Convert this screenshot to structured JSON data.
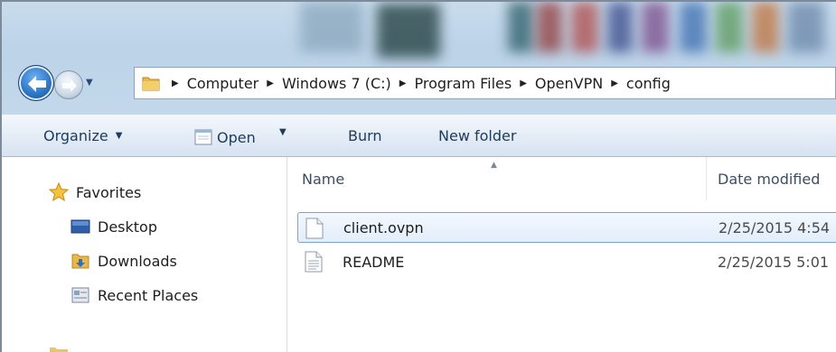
{
  "address_bar": {
    "crumbs": [
      "Computer",
      "Windows 7 (C:)",
      "Program Files",
      "OpenVPN",
      "config"
    ]
  },
  "toolbar": {
    "organize_label": "Organize",
    "open_label": "Open",
    "burn_label": "Burn",
    "new_folder_label": "New folder"
  },
  "nav_pane": {
    "favorites_label": "Favorites",
    "items": [
      {
        "label": "Desktop",
        "icon": "desktop-icon"
      },
      {
        "label": "Downloads",
        "icon": "downloads-folder-icon"
      },
      {
        "label": "Recent Places",
        "icon": "recent-places-icon"
      }
    ]
  },
  "file_list": {
    "columns": {
      "name": "Name",
      "date_modified": "Date modified"
    },
    "rows": [
      {
        "name": "client.ovpn",
        "date": "2/25/2015 4:54",
        "selected": true
      },
      {
        "name": "README",
        "date": "2/25/2015 5:01",
        "selected": false
      }
    ]
  },
  "colors": {
    "selection_border": "#7da2ce",
    "glass": "#c3d8ea",
    "command_bar": "#e3ecf6"
  }
}
